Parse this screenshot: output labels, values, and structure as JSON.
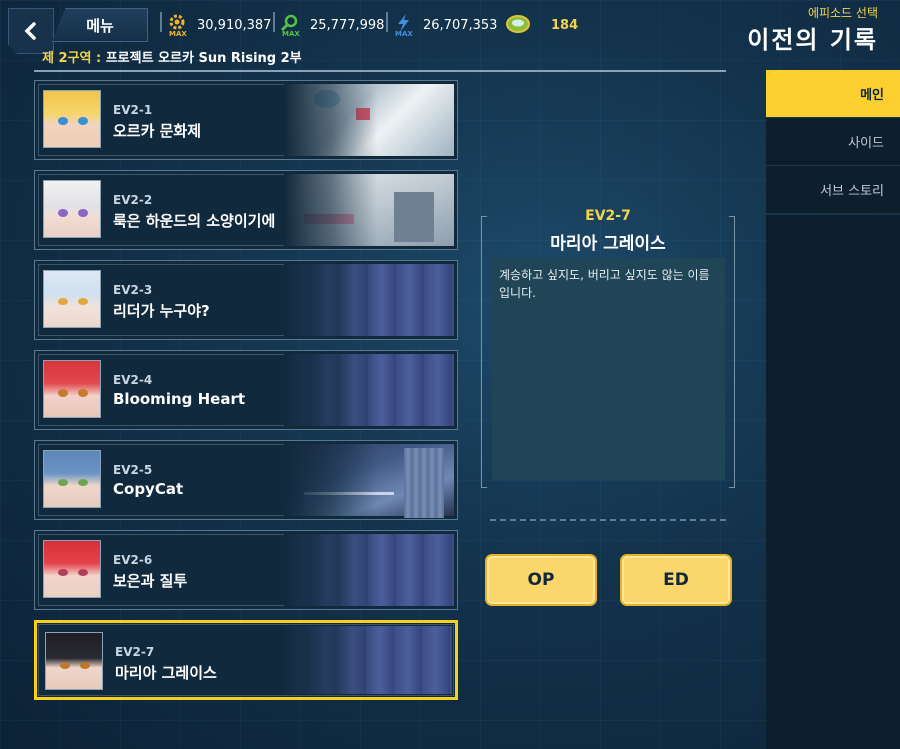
{
  "header": {
    "menu_label": "메뉴",
    "episode_select_label": "에피소드 선택",
    "title": "이전의 기록",
    "region_label": "제 2구역 :",
    "region_name": "프로젝트 오르카 Sun Rising 2부"
  },
  "resources": [
    {
      "name": "gear-resource",
      "value": "30,910,387",
      "badge": "MAX",
      "color": "#f2b329"
    },
    {
      "name": "green-resource",
      "value": "25,777,998",
      "badge": "MAX",
      "color": "#52c443"
    },
    {
      "name": "blue-resource",
      "value": "26,707,353",
      "badge": "MAX",
      "color": "#3f8fe0"
    },
    {
      "name": "coin-resource",
      "value": "184",
      "color": "#f6d44a"
    }
  ],
  "episodes": [
    {
      "code": "EV2-1",
      "name": "오르카 문화제"
    },
    {
      "code": "EV2-2",
      "name": "룩은 하운드의 소양이기에"
    },
    {
      "code": "EV2-3",
      "name": "리더가 누구야?"
    },
    {
      "code": "EV2-4",
      "name": "Blooming Heart"
    },
    {
      "code": "EV2-5",
      "name": "CopyCat"
    },
    {
      "code": "EV2-6",
      "name": "보은과 질투"
    },
    {
      "code": "EV2-7",
      "name": "마리아 그레이스"
    }
  ],
  "selected_index": 6,
  "detail": {
    "code": "EV2-7",
    "name": "마리아 그레이스",
    "description": "계승하고 싶지도, 버리고 싶지도 않는 이름입니다."
  },
  "buttons": {
    "op": "OP",
    "ed": "ED"
  },
  "tabs": [
    {
      "label": "메인",
      "active": true
    },
    {
      "label": "사이드",
      "active": false
    },
    {
      "label": "서브 스토리",
      "active": false
    }
  ],
  "colors": {
    "accent": "#f6cf1f",
    "button": "#fbd66a"
  }
}
